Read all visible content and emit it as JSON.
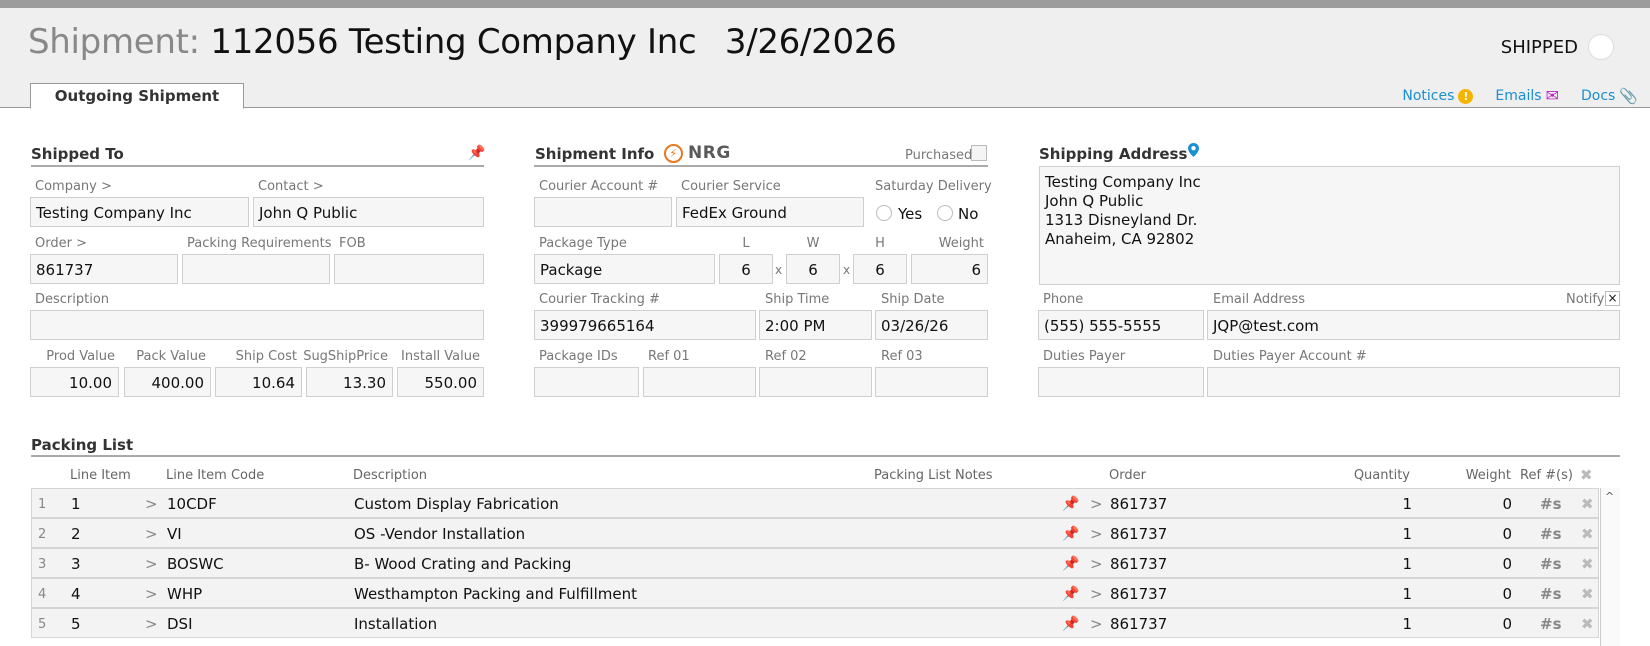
{
  "header": {
    "label": "Shipment:",
    "number": "112056",
    "company": "Testing Company Inc",
    "date": "3/26/2026",
    "status": "SHIPPED",
    "tab": "Outgoing Shipment",
    "links": {
      "notices": "Notices",
      "emails": "Emails",
      "docs": "Docs"
    }
  },
  "shipped_to": {
    "title": "Shipped To",
    "company_label": "Company >",
    "company": "Testing Company Inc",
    "contact_label": "Contact >",
    "contact": "John Q Public",
    "order_label": "Order >",
    "order": "861737",
    "packing_req_label": "Packing Requirements",
    "packing_req": "",
    "fob_label": "FOB",
    "fob": "",
    "description_label": "Description",
    "description": "",
    "prod_value_label": "Prod Value",
    "prod_value": "10.00",
    "pack_value_label": "Pack Value",
    "pack_value": "400.00",
    "ship_cost_label": "Ship Cost",
    "ship_cost": "10.64",
    "sug_ship_label": "SugShipPrice",
    "sug_ship": "13.30",
    "install_label": "Install Value",
    "install": "550.00"
  },
  "shipment_info": {
    "title": "Shipment Info",
    "carrier": "NRG",
    "purchased_label": "Purchased",
    "courier_account_label": "Courier Account #",
    "courier_account": "",
    "courier_service_label": "Courier Service",
    "courier_service": "FedEx Ground",
    "saturday_label": "Saturday Delivery",
    "yes": "Yes",
    "no": "No",
    "package_type_label": "Package Type",
    "package_type": "Package",
    "l_label": "L",
    "w_label": "W",
    "h_label": "H",
    "weight_label": "Weight",
    "l": "6",
    "w": "6",
    "h": "6",
    "weight": "6",
    "x": "x",
    "tracking_label": "Courier Tracking #",
    "tracking": "399979665164",
    "ship_time_label": "Ship Time",
    "ship_time": "2:00 PM",
    "ship_date_label": "Ship Date",
    "ship_date": "03/26/26",
    "package_ids_label": "Package IDs",
    "ref01_label": "Ref 01",
    "ref02_label": "Ref 02",
    "ref03_label": "Ref 03",
    "package_ids": "",
    "ref01": "",
    "ref02": "",
    "ref03": ""
  },
  "shipping_address": {
    "title": "Shipping Address",
    "lines": [
      "Testing Company Inc",
      "John Q Public",
      "1313 Disneyland Dr.",
      "Anaheim, CA 92802"
    ],
    "phone_label": "Phone",
    "phone": "(555) 555-5555",
    "email_label": "Email Address",
    "email": "JQP@test.com",
    "notify_label": "Notify",
    "notify_mark": "×",
    "duties_payer_label": "Duties Payer",
    "duties_payer": "",
    "duties_account_label": "Duties Payer Account #",
    "duties_account": ""
  },
  "packing_list": {
    "title": "Packing List",
    "headers": {
      "line_item": "Line Item",
      "code": "Line Item Code",
      "description": "Description",
      "notes": "Packing List Notes",
      "order": "Order",
      "quantity": "Quantity",
      "weight": "Weight",
      "refs": "Ref #(s)"
    },
    "rows": [
      {
        "num": "1",
        "line": "1",
        "code": "10CDF",
        "description": "Custom Display Fabrication",
        "order": "861737",
        "quantity": "1",
        "weight": "0"
      },
      {
        "num": "2",
        "line": "2",
        "code": "VI",
        "description": "OS -Vendor Installation",
        "order": "861737",
        "quantity": "1",
        "weight": "0"
      },
      {
        "num": "3",
        "line": "3",
        "code": "BOSWC",
        "description": "B- Wood Crating and Packing",
        "order": "861737",
        "quantity": "1",
        "weight": "0"
      },
      {
        "num": "4",
        "line": "4",
        "code": "WHP",
        "description": "Westhampton Packing and Fulfillment",
        "order": "861737",
        "quantity": "1",
        "weight": "0"
      },
      {
        "num": "5",
        "line": "5",
        "code": "DSI",
        "description": "Installation",
        "order": "861737",
        "quantity": "1",
        "weight": "0"
      }
    ],
    "gt": ">",
    "refs_symbol": "#s",
    "delete_symbol": "✖",
    "pin_symbol": "📌"
  },
  "colors": {
    "accent": "#1a8fd1",
    "carrier": "#e87722",
    "email_icon": "#c020c0",
    "warn": "#f4b400"
  }
}
